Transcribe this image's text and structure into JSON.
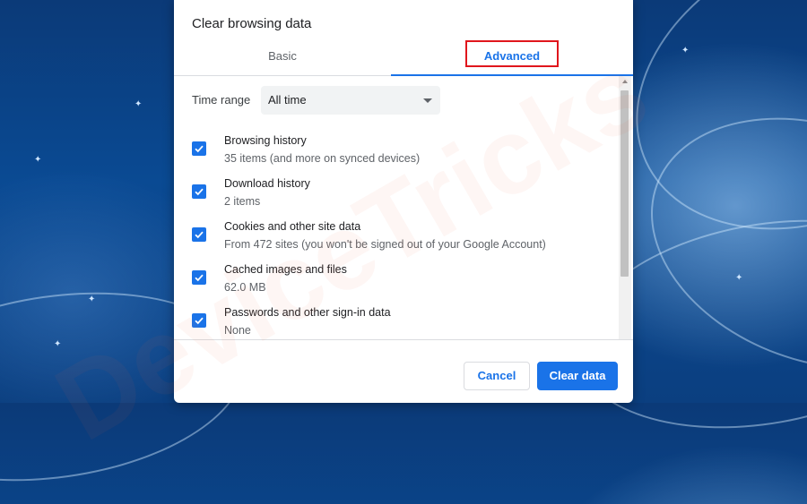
{
  "dialog": {
    "title": "Clear browsing data",
    "tabs": [
      {
        "label": "Basic",
        "active": false
      },
      {
        "label": "Advanced",
        "active": true
      }
    ],
    "time_range": {
      "label": "Time range",
      "value": "All time"
    },
    "items": [
      {
        "title": "Browsing history",
        "subtitle": "35 items (and more on synced devices)",
        "checked": true
      },
      {
        "title": "Download history",
        "subtitle": "2 items",
        "checked": true
      },
      {
        "title": "Cookies and other site data",
        "subtitle": "From 472 sites (you won't be signed out of your Google Account)",
        "checked": true
      },
      {
        "title": "Cached images and files",
        "subtitle": "62.0 MB",
        "checked": true
      },
      {
        "title": "Passwords and other sign-in data",
        "subtitle": "None",
        "checked": true
      }
    ],
    "buttons": {
      "cancel": "Cancel",
      "clear": "Clear data"
    }
  },
  "watermark": "DeviceTricks",
  "colors": {
    "accent": "#1a73e8",
    "highlight": "#e0161c",
    "background": "#0b3f80"
  }
}
